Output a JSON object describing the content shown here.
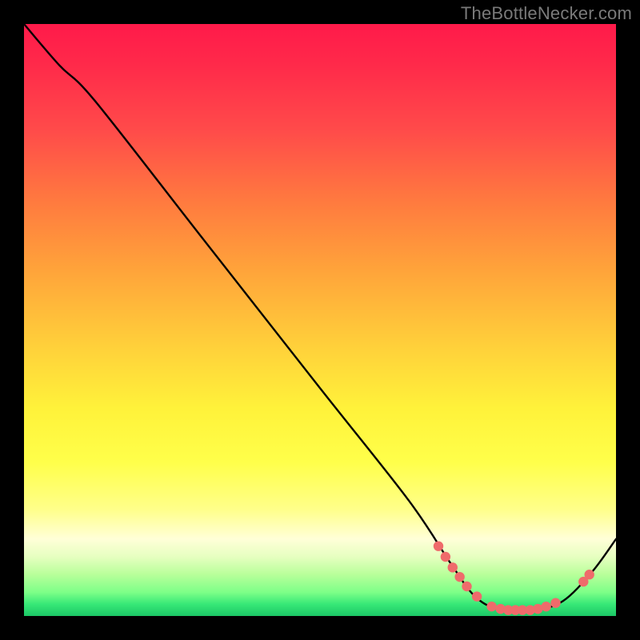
{
  "watermark": "TheBottleNecker.com",
  "chart_data": {
    "type": "line",
    "title": "",
    "xlabel": "",
    "ylabel": "",
    "xlim": [
      0,
      1
    ],
    "ylim": [
      0,
      1
    ],
    "series": [
      {
        "name": "curve",
        "points": [
          {
            "x": 0.0,
            "y": 1.0
          },
          {
            "x": 0.06,
            "y": 0.93
          },
          {
            "x": 0.12,
            "y": 0.87
          },
          {
            "x": 0.3,
            "y": 0.64
          },
          {
            "x": 0.5,
            "y": 0.385
          },
          {
            "x": 0.65,
            "y": 0.195
          },
          {
            "x": 0.72,
            "y": 0.09
          },
          {
            "x": 0.76,
            "y": 0.035
          },
          {
            "x": 0.8,
            "y": 0.012
          },
          {
            "x": 0.86,
            "y": 0.01
          },
          {
            "x": 0.91,
            "y": 0.025
          },
          {
            "x": 0.96,
            "y": 0.075
          },
          {
            "x": 1.0,
            "y": 0.13
          }
        ]
      }
    ],
    "markers": [
      {
        "x": 0.7,
        "y": 0.118
      },
      {
        "x": 0.712,
        "y": 0.1
      },
      {
        "x": 0.724,
        "y": 0.082
      },
      {
        "x": 0.736,
        "y": 0.066
      },
      {
        "x": 0.748,
        "y": 0.05
      },
      {
        "x": 0.765,
        "y": 0.033
      },
      {
        "x": 0.79,
        "y": 0.016
      },
      {
        "x": 0.805,
        "y": 0.012
      },
      {
        "x": 0.818,
        "y": 0.01
      },
      {
        "x": 0.83,
        "y": 0.01
      },
      {
        "x": 0.842,
        "y": 0.01
      },
      {
        "x": 0.855,
        "y": 0.01
      },
      {
        "x": 0.868,
        "y": 0.012
      },
      {
        "x": 0.882,
        "y": 0.016
      },
      {
        "x": 0.898,
        "y": 0.022
      },
      {
        "x": 0.945,
        "y": 0.058
      },
      {
        "x": 0.955,
        "y": 0.07
      }
    ],
    "marker_color": "#ef6b6b",
    "curve_color": "#000000",
    "gradient_stops": [
      {
        "t": 0.0,
        "color": "#ff1a4a"
      },
      {
        "t": 0.5,
        "color": "#ffe23a"
      },
      {
        "t": 0.9,
        "color": "#f8ffc8"
      },
      {
        "t": 1.0,
        "color": "#1cc766"
      }
    ]
  }
}
